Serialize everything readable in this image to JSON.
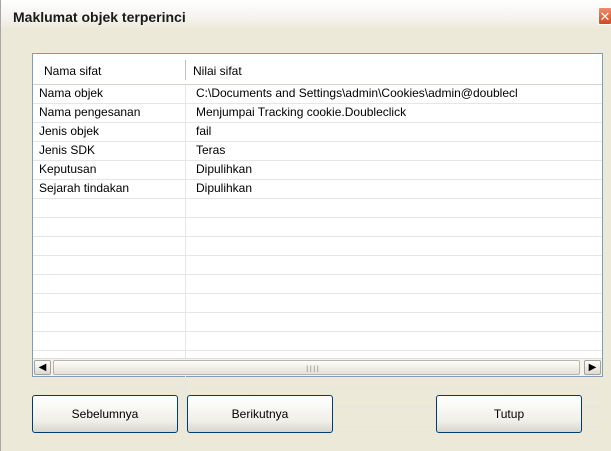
{
  "window": {
    "title": "Maklumat objek terperinci",
    "close_glyph": "✕"
  },
  "table": {
    "headers": [
      "Nama sifat",
      "Nilai sifat"
    ],
    "rows": [
      [
        "Nama objek",
        "C:\\Documents and Settings\\admin\\Cookies\\admin@doublecl"
      ],
      [
        "Nama pengesanan",
        "Menjumpai Tracking cookie.Doubleclick"
      ],
      [
        "Jenis objek",
        "fail"
      ],
      [
        "Jenis SDK",
        "Teras"
      ],
      [
        "Keputusan",
        "Dipulihkan"
      ],
      [
        "Sejarah tindakan",
        "Dipulihkan"
      ]
    ],
    "empty_row_count": 12
  },
  "scrollbar": {
    "left_glyph": "◀",
    "right_glyph": "▶",
    "grip": "IIII"
  },
  "buttons": {
    "previous": "Sebelumnya",
    "next": "Berikutnya",
    "close": "Tutup"
  },
  "colors": {
    "window_bg": "#ece9d8",
    "button_border": "#003c74",
    "close_button": "#d14a1f"
  }
}
